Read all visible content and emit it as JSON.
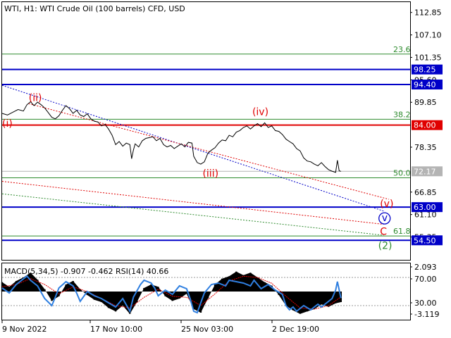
{
  "chart_data": {
    "type": "line",
    "title": "WTI, H1:  WTI Crude Oil (100 barrels) CFD, USD",
    "price_axis": {
      "range": [
        49.5,
        115.5
      ],
      "ticks": [
        "112.85",
        "107.10",
        "101.35",
        "95.60",
        "89.85",
        "78.35",
        "66.85",
        "61.10",
        "55.35"
      ]
    },
    "x_ticks": [
      "9 Nov 2022",
      "17 Nov 10:00",
      "25 Nov 03:00",
      "2 Dec 19:00"
    ],
    "horizontal_levels": [
      {
        "label": "98.25",
        "value": 98.25,
        "color": "#0000c8",
        "style": "thick"
      },
      {
        "label": "94.40",
        "value": 94.4,
        "color": "#0000c8",
        "style": "thick"
      },
      {
        "label": "84.00",
        "value": 84.0,
        "color": "#e00000",
        "style": "thick"
      },
      {
        "label": "72.17",
        "value": 72.17,
        "color": "#b4b4b4",
        "style": "thin"
      },
      {
        "label": "63.00",
        "value": 63.0,
        "color": "#0000c8",
        "style": "thick"
      },
      {
        "label": "54.50",
        "value": 54.5,
        "color": "#0000c8",
        "style": "thick"
      }
    ],
    "fib_levels": [
      {
        "label": "23.6",
        "value": 102.2
      },
      {
        "label": "38.2",
        "value": 85.5
      },
      {
        "label": "50.0",
        "value": 70.5
      },
      {
        "label": "61.8",
        "value": 55.6
      }
    ],
    "wave_labels": [
      {
        "text": "(ii)",
        "x": 15,
        "y": 90.2,
        "color": "#e00000"
      },
      {
        "text": "(i)",
        "x": 0,
        "y": 83.6,
        "color": "#e00000"
      },
      {
        "text": "(iv)",
        "x": 141,
        "y": 86.6,
        "color": "#e00000"
      },
      {
        "text": "(iii)",
        "x": 113,
        "y": 70.8,
        "color": "#e00000"
      },
      {
        "text": "(v)",
        "x": 213,
        "y": 63.0,
        "color": "#e00000"
      },
      {
        "text": "v",
        "x": 214,
        "y": 59.4,
        "color": "#0000c8"
      },
      {
        "text": "C",
        "x": 213,
        "y": 55.9,
        "color": "#e00000"
      },
      {
        "text": "(2)",
        "x": 212,
        "y": 52.3,
        "color": "#2e8b2e"
      }
    ],
    "price_series": [
      [
        0,
        87.0
      ],
      [
        3,
        86.6
      ],
      [
        6,
        87.3
      ],
      [
        9,
        88.0
      ],
      [
        12,
        87.6
      ],
      [
        14,
        89.2
      ],
      [
        16,
        90.0
      ],
      [
        18,
        89.0
      ],
      [
        20,
        89.9
      ],
      [
        22,
        89.2
      ],
      [
        24,
        88.4
      ],
      [
        26,
        87.2
      ],
      [
        28,
        86.0
      ],
      [
        30,
        85.6
      ],
      [
        32,
        86.4
      ],
      [
        34,
        87.8
      ],
      [
        36,
        89.0
      ],
      [
        38,
        88.2
      ],
      [
        40,
        87.0
      ],
      [
        42,
        87.8
      ],
      [
        44,
        86.6
      ],
      [
        46,
        86.2
      ],
      [
        48,
        86.9
      ],
      [
        50,
        85.6
      ],
      [
        52,
        85.0
      ],
      [
        54,
        84.8
      ],
      [
        56,
        83.8
      ],
      [
        58,
        84.2
      ],
      [
        60,
        83.0
      ],
      [
        62,
        81.4
      ],
      [
        64,
        79.0
      ],
      [
        66,
        79.8
      ],
      [
        68,
        78.6
      ],
      [
        70,
        79.4
      ],
      [
        72,
        79.0
      ],
      [
        73,
        75.4
      ],
      [
        74,
        77.6
      ],
      [
        75,
        79.2
      ],
      [
        77,
        78.4
      ],
      [
        79,
        80.0
      ],
      [
        81,
        80.6
      ],
      [
        83,
        80.8
      ],
      [
        85,
        81.0
      ],
      [
        87,
        80.0
      ],
      [
        89,
        80.6
      ],
      [
        91,
        79.0
      ],
      [
        93,
        78.4
      ],
      [
        95,
        78.8
      ],
      [
        97,
        78.0
      ],
      [
        99,
        78.6
      ],
      [
        101,
        79.2
      ],
      [
        103,
        78.4
      ],
      [
        105,
        79.6
      ],
      [
        107,
        79.4
      ],
      [
        108,
        76.0
      ],
      [
        110,
        74.4
      ],
      [
        112,
        74.0
      ],
      [
        114,
        74.6
      ],
      [
        116,
        76.8
      ],
      [
        118,
        77.6
      ],
      [
        120,
        78.2
      ],
      [
        122,
        79.4
      ],
      [
        124,
        80.2
      ],
      [
        126,
        80.0
      ],
      [
        128,
        81.4
      ],
      [
        130,
        81.0
      ],
      [
        132,
        82.2
      ],
      [
        134,
        82.6
      ],
      [
        136,
        83.4
      ],
      [
        138,
        83.8
      ],
      [
        140,
        83.0
      ],
      [
        142,
        83.8
      ],
      [
        144,
        84.4
      ],
      [
        146,
        83.6
      ],
      [
        148,
        84.6
      ],
      [
        150,
        83.4
      ],
      [
        152,
        83.8
      ],
      [
        154,
        82.6
      ],
      [
        156,
        82.4
      ],
      [
        158,
        81.6
      ],
      [
        160,
        80.4
      ],
      [
        162,
        79.8
      ],
      [
        164,
        79.2
      ],
      [
        166,
        78.0
      ],
      [
        168,
        77.4
      ],
      [
        170,
        75.6
      ],
      [
        172,
        74.8
      ],
      [
        174,
        74.6
      ],
      [
        176,
        74.0
      ],
      [
        178,
        73.6
      ],
      [
        180,
        74.4
      ],
      [
        182,
        73.4
      ],
      [
        184,
        72.6
      ],
      [
        186,
        72.2
      ],
      [
        188,
        71.9
      ],
      [
        189,
        75.0
      ],
      [
        190,
        72.3
      ],
      [
        191,
        72.17
      ]
    ],
    "macd_title": "MACD(5,34,5) -0.907 -0.462 RSI(14) 40.66",
    "macd_axis": {
      "ticks": [
        "2.093",
        "70.00",
        "30.00",
        "-3.119"
      ]
    },
    "macd_histogram": [
      [
        0,
        0.8
      ],
      [
        4,
        0.4
      ],
      [
        8,
        0.9
      ],
      [
        12,
        1.2
      ],
      [
        16,
        1.6
      ],
      [
        20,
        1.0
      ],
      [
        24,
        0.2
      ],
      [
        28,
        -0.8
      ],
      [
        32,
        -0.4
      ],
      [
        36,
        0.6
      ],
      [
        40,
        0.9
      ],
      [
        44,
        0.2
      ],
      [
        48,
        -0.3
      ],
      [
        52,
        -0.7
      ],
      [
        56,
        -0.9
      ],
      [
        60,
        -1.4
      ],
      [
        64,
        -1.7
      ],
      [
        68,
        -1.2
      ],
      [
        72,
        -1.9
      ],
      [
        76,
        -0.9
      ],
      [
        80,
        0.3
      ],
      [
        84,
        0.6
      ],
      [
        88,
        0.4
      ],
      [
        92,
        -0.4
      ],
      [
        96,
        -0.8
      ],
      [
        100,
        -0.6
      ],
      [
        104,
        -0.2
      ],
      [
        108,
        -1.5
      ],
      [
        112,
        -1.8
      ],
      [
        116,
        -0.6
      ],
      [
        120,
        0.6
      ],
      [
        124,
        1.1
      ],
      [
        128,
        1.3
      ],
      [
        132,
        1.7
      ],
      [
        136,
        1.4
      ],
      [
        140,
        1.6
      ],
      [
        144,
        1.2
      ],
      [
        148,
        0.8
      ],
      [
        152,
        0.5
      ],
      [
        156,
        -0.3
      ],
      [
        160,
        -1.2
      ],
      [
        164,
        -1.6
      ],
      [
        168,
        -1.9
      ],
      [
        172,
        -1.7
      ],
      [
        176,
        -1.5
      ],
      [
        180,
        -1.1
      ],
      [
        184,
        -1.3
      ],
      [
        188,
        -1.0
      ],
      [
        191,
        -0.9
      ]
    ],
    "macd_signal": [
      [
        0,
        0.4
      ],
      [
        8,
        0.6
      ],
      [
        16,
        1.1
      ],
      [
        24,
        0.6
      ],
      [
        32,
        -0.2
      ],
      [
        40,
        0.4
      ],
      [
        48,
        0.0
      ],
      [
        56,
        -0.6
      ],
      [
        64,
        -1.2
      ],
      [
        72,
        -1.4
      ],
      [
        80,
        -0.5
      ],
      [
        88,
        0.2
      ],
      [
        96,
        -0.4
      ],
      [
        104,
        -0.5
      ],
      [
        112,
        -1.2
      ],
      [
        120,
        -0.2
      ],
      [
        128,
        0.9
      ],
      [
        136,
        1.3
      ],
      [
        144,
        1.2
      ],
      [
        152,
        0.7
      ],
      [
        160,
        -0.4
      ],
      [
        168,
        -1.4
      ],
      [
        176,
        -1.5
      ],
      [
        184,
        -1.2
      ],
      [
        191,
        -0.46
      ]
    ],
    "rsi_series": [
      [
        0,
        55
      ],
      [
        4,
        48
      ],
      [
        8,
        60
      ],
      [
        12,
        68
      ],
      [
        14,
        72
      ],
      [
        16,
        66
      ],
      [
        20,
        58
      ],
      [
        24,
        40
      ],
      [
        26,
        35
      ],
      [
        28,
        30
      ],
      [
        30,
        42
      ],
      [
        32,
        55
      ],
      [
        36,
        64
      ],
      [
        40,
        58
      ],
      [
        42,
        48
      ],
      [
        44,
        36
      ],
      [
        48,
        50
      ],
      [
        52,
        44
      ],
      [
        56,
        40
      ],
      [
        60,
        34
      ],
      [
        64,
        28
      ],
      [
        68,
        40
      ],
      [
        72,
        22
      ],
      [
        74,
        42
      ],
      [
        78,
        60
      ],
      [
        80,
        66
      ],
      [
        84,
        62
      ],
      [
        86,
        55
      ],
      [
        88,
        44
      ],
      [
        92,
        52
      ],
      [
        96,
        46
      ],
      [
        100,
        58
      ],
      [
        104,
        54
      ],
      [
        106,
        40
      ],
      [
        108,
        22
      ],
      [
        110,
        20
      ],
      [
        112,
        34
      ],
      [
        114,
        48
      ],
      [
        118,
        60
      ],
      [
        122,
        62
      ],
      [
        126,
        58
      ],
      [
        128,
        66
      ],
      [
        132,
        64
      ],
      [
        136,
        62
      ],
      [
        140,
        58
      ],
      [
        142,
        66
      ],
      [
        146,
        54
      ],
      [
        150,
        60
      ],
      [
        154,
        52
      ],
      [
        158,
        46
      ],
      [
        160,
        30
      ],
      [
        162,
        24
      ],
      [
        164,
        28
      ],
      [
        166,
        22
      ],
      [
        170,
        30
      ],
      [
        174,
        24
      ],
      [
        178,
        32
      ],
      [
        180,
        28
      ],
      [
        184,
        36
      ],
      [
        186,
        40
      ],
      [
        188,
        52
      ],
      [
        189,
        64
      ],
      [
        191,
        40.66
      ]
    ],
    "dotted_lines": [
      {
        "color": "#0000c8",
        "from": [
          0,
          94.2
        ],
        "to": [
          215,
          62.0
        ]
      },
      {
        "color": "#e00000",
        "from": [
          15,
          89.5
        ],
        "to": [
          218,
          65.0
        ]
      },
      {
        "color": "#e00000",
        "from": [
          0,
          69.6
        ],
        "to": [
          215,
          58.6
        ]
      },
      {
        "color": "#2e8b2e",
        "from": [
          0,
          66.4
        ],
        "to": [
          215,
          55.8
        ]
      }
    ]
  }
}
